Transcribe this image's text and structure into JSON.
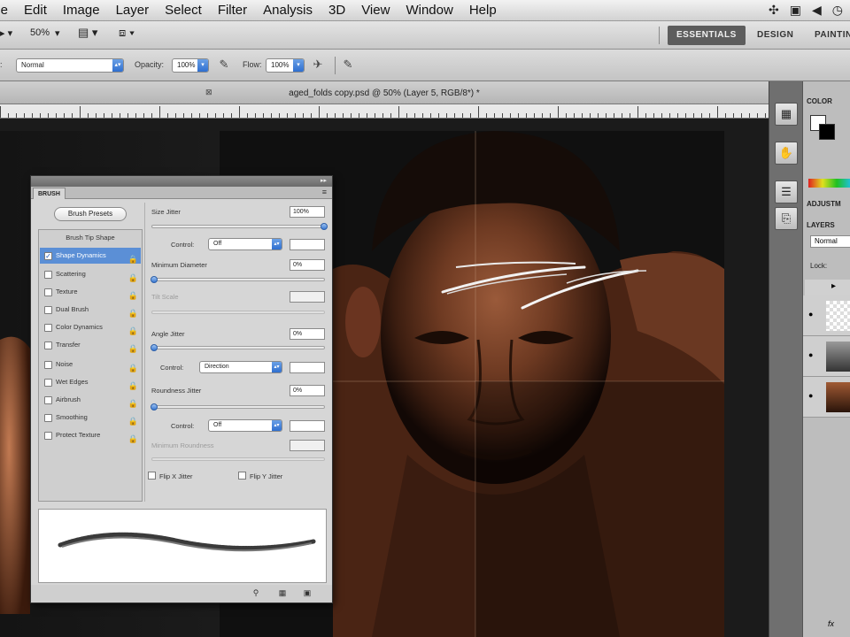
{
  "menubar": {
    "items": [
      "ile",
      "Edit",
      "Image",
      "Layer",
      "Select",
      "Filter",
      "Analysis",
      "3D",
      "View",
      "Window",
      "Help"
    ]
  },
  "appbar": {
    "zoom": "50%",
    "workspaces": [
      "ESSENTIALS",
      "DESIGN",
      "PAINTIN"
    ]
  },
  "options": {
    "mode_value": "Normal",
    "opacity_label": "Opacity:",
    "opacity_value": "100%",
    "flow_label": "Flow:",
    "flow_value": "100%"
  },
  "document": {
    "title": "aged_folds copy.psd @ 50% (Layer 5, RGB/8*) *"
  },
  "right_panel": {
    "color_tab": "COLOR",
    "adjust_tab": "ADJUSTM",
    "layers_tab": "LAYERS",
    "blend_value": "Normal",
    "lock_label": "Lock:"
  },
  "brush_panel": {
    "tab": "BRUSH",
    "presets_button": "Brush Presets",
    "list_header": "Brush Tip Shape",
    "items": [
      {
        "label": "Shape Dynamics",
        "checked": true,
        "selected": true
      },
      {
        "label": "Scattering",
        "checked": false,
        "selected": false
      },
      {
        "label": "Texture",
        "checked": false,
        "selected": false
      },
      {
        "label": "Dual Brush",
        "checked": false,
        "selected": false
      },
      {
        "label": "Color Dynamics",
        "checked": false,
        "selected": false
      },
      {
        "label": "Transfer",
        "checked": false,
        "selected": false
      },
      {
        "label": "Noise",
        "checked": false,
        "selected": false
      },
      {
        "label": "Wet Edges",
        "checked": false,
        "selected": false
      },
      {
        "label": "Airbrush",
        "checked": false,
        "selected": false
      },
      {
        "label": "Smoothing",
        "checked": false,
        "selected": false
      },
      {
        "label": "Protect Texture",
        "checked": false,
        "selected": false
      }
    ],
    "size_jitter_label": "Size Jitter",
    "size_jitter_value": "100%",
    "size_jitter_level": 1.0,
    "control_label": "Control:",
    "size_control_value": "Off",
    "min_diameter_label": "Minimum Diameter",
    "min_diameter_value": "0%",
    "tilt_scale_label": "Tilt Scale",
    "angle_jitter_label": "Angle Jitter",
    "angle_jitter_value": "0%",
    "angle_control_value": "Direction",
    "roundness_jitter_label": "Roundness Jitter",
    "roundness_jitter_value": "0%",
    "roundness_control_value": "Off",
    "min_roundness_label": "Minimum Roundness",
    "flip_x_label": "Flip X Jitter",
    "flip_y_label": "Flip Y Jitter"
  }
}
